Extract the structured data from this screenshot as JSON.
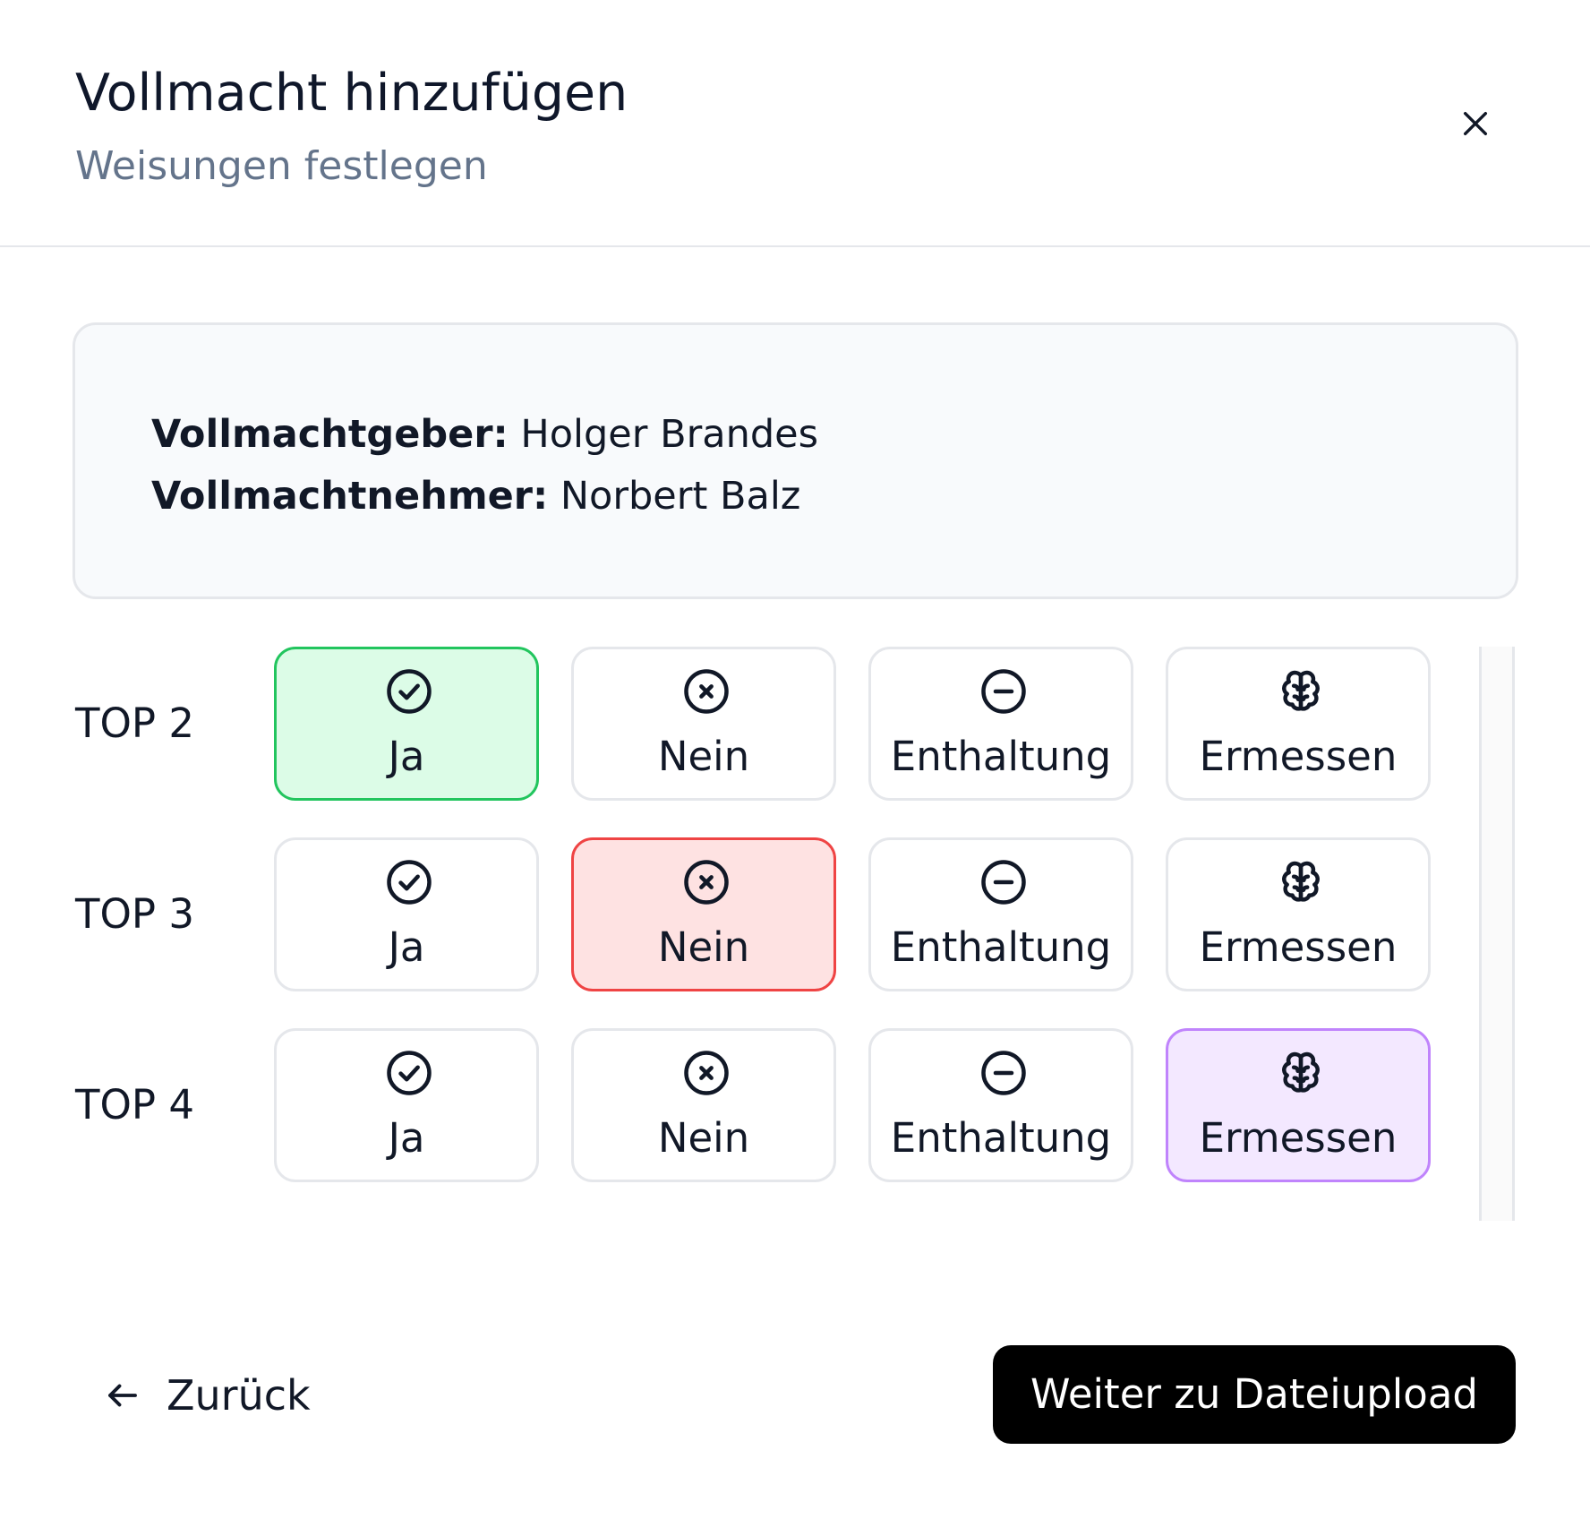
{
  "header": {
    "title": "Vollmacht hinzufügen",
    "subtitle": "Weisungen festlegen",
    "close_icon": "close-icon"
  },
  "info": {
    "grantor_label": "Vollmachtgeber:",
    "grantor_value": "Holger Brandes",
    "grantee_label": "Vollmachtnehmer:",
    "grantee_value": "Norbert Balz"
  },
  "options": {
    "yes": "Ja",
    "no": "Nein",
    "abstain": "Enthaltung",
    "discretion": "Ermessen"
  },
  "items": [
    {
      "label": "TOP 2",
      "selected": "yes"
    },
    {
      "label": "TOP 3",
      "selected": "no"
    },
    {
      "label": "TOP 4",
      "selected": "discretion"
    }
  ],
  "footer": {
    "back_label": "Zurück",
    "next_label": "Weiter zu Dateiupload"
  },
  "colors": {
    "yes_bg": "#dcfce7",
    "yes_border": "#22c55e",
    "no_bg": "#fee2e2",
    "no_border": "#ef4444",
    "discretion_bg": "#f3e8ff",
    "discretion_border": "#c084fc",
    "primary": "#000000"
  }
}
